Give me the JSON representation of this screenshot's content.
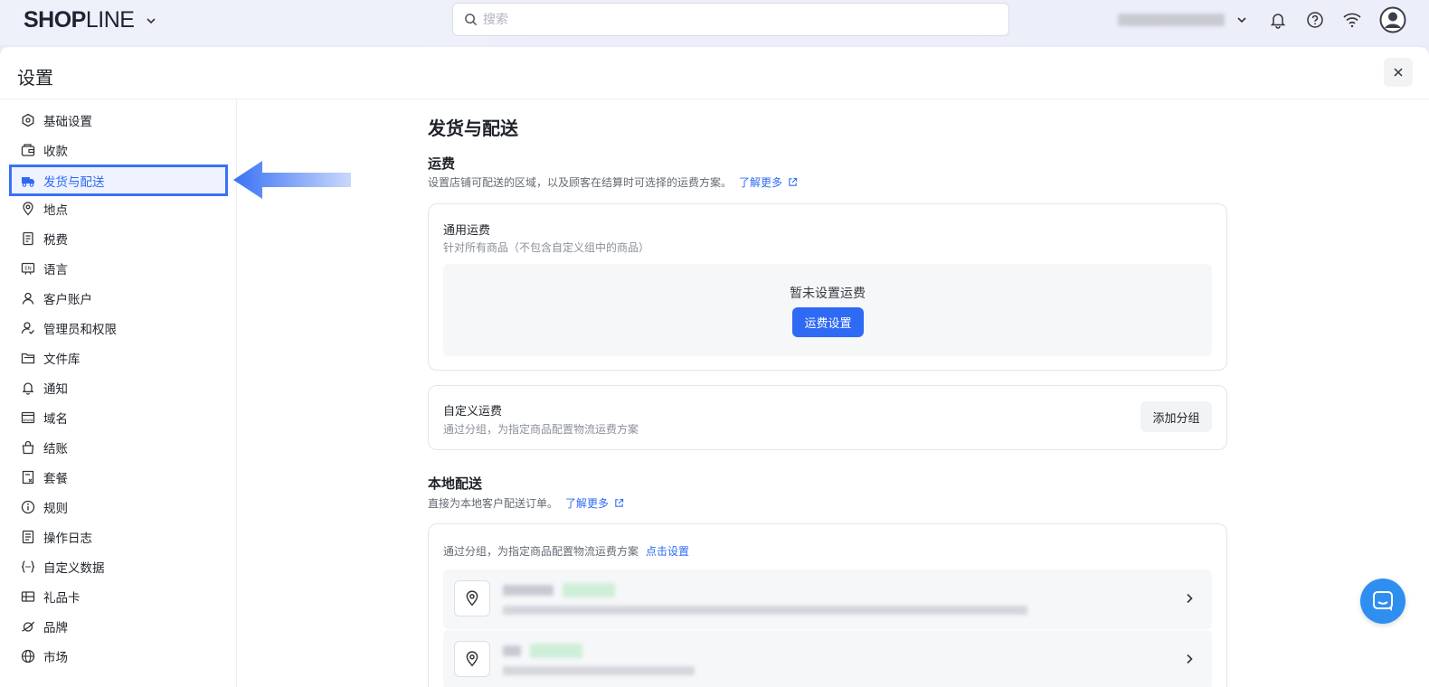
{
  "topbar": {
    "logo_bold": "SHOP",
    "logo_light": "LINE",
    "search_placeholder": "搜索"
  },
  "panel": {
    "title": "设置"
  },
  "sidebar": {
    "items": [
      {
        "label": "基础设置",
        "icon": "settings-hex-icon"
      },
      {
        "label": "收款",
        "icon": "wallet-icon"
      },
      {
        "label": "发货与配送",
        "icon": "truck-icon",
        "active": true
      },
      {
        "label": "地点",
        "icon": "location-pin-icon"
      },
      {
        "label": "税费",
        "icon": "tax-receipt-icon"
      },
      {
        "label": "语言",
        "icon": "language-icon"
      },
      {
        "label": "客户账户",
        "icon": "user-icon"
      },
      {
        "label": "管理员和权限",
        "icon": "user-check-icon"
      },
      {
        "label": "文件库",
        "icon": "folder-icon"
      },
      {
        "label": "通知",
        "icon": "bell-icon"
      },
      {
        "label": "域名",
        "icon": "domain-icon"
      },
      {
        "label": "结账",
        "icon": "shopping-bag-icon"
      },
      {
        "label": "套餐",
        "icon": "plan-icon"
      },
      {
        "label": "规则",
        "icon": "info-icon"
      },
      {
        "label": "操作日志",
        "icon": "log-icon"
      },
      {
        "label": "自定义数据",
        "icon": "custom-data-icon"
      },
      {
        "label": "礼品卡",
        "icon": "gift-card-icon"
      },
      {
        "label": "品牌",
        "icon": "brand-icon"
      },
      {
        "label": "市场",
        "icon": "globe-icon"
      }
    ]
  },
  "main": {
    "title": "发货与配送",
    "shipping_fee": {
      "heading": "运费",
      "description": "设置店铺可配送的区域，以及顾客在结算时可选择的运费方案。",
      "learn_more": "了解更多"
    },
    "general_card": {
      "title": "通用运费",
      "subtitle": "针对所有商品（不包含自定义组中的商品）",
      "empty_text": "暂未设置运费",
      "button": "运费设置"
    },
    "custom_card": {
      "title": "自定义运费",
      "subtitle": "通过分组，为指定商品配置物流运费方案",
      "button": "添加分组"
    },
    "local_delivery": {
      "heading": "本地配送",
      "description": "直接为本地客户配送订单。",
      "learn_more": "了解更多",
      "card_text": "通过分组，为指定商品配置物流运费方案",
      "card_link": "点击设置"
    }
  },
  "colors": {
    "accent": "#2f6af5",
    "highlight_border": "#3a72f5",
    "chat": "#2f8ff0"
  }
}
